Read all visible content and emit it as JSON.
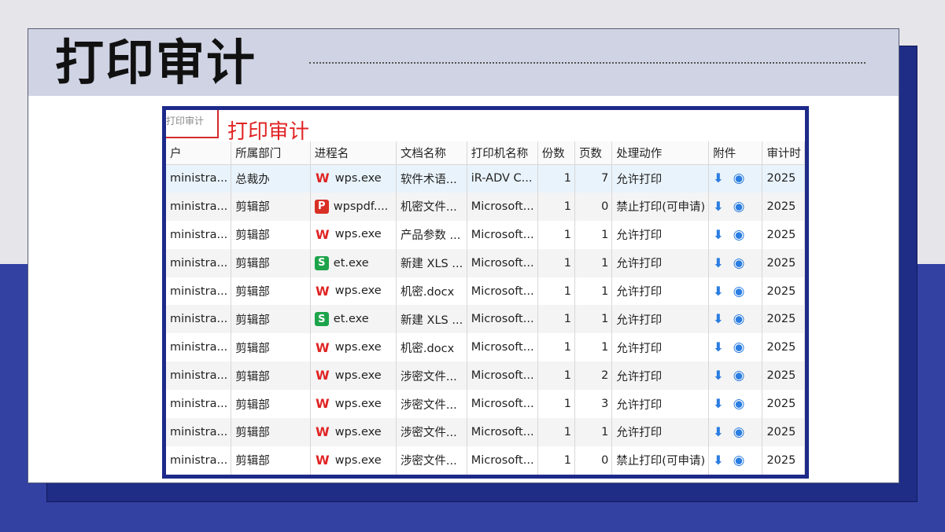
{
  "slide_title": "打印审计",
  "screenshot": {
    "tab_label": "打印审计",
    "overlay_label": "打印审计",
    "columns": [
      "户",
      "所属部门",
      "进程名",
      "文档名称",
      "打印机名称",
      "份数",
      "页数",
      "处理动作",
      "附件",
      "审计时"
    ],
    "rows": [
      {
        "user": "ministra...",
        "dept": "总裁办",
        "proc_icon": "wps-icon",
        "proc": "wps.exe",
        "doc": "软件术语...",
        "printer": "iR-ADV C...",
        "copies": "1",
        "pages": "7",
        "action": "允许打印",
        "time": "2025"
      },
      {
        "user": "ministra...",
        "dept": "剪辑部",
        "proc_icon": "pdf-icon",
        "proc": "wpspdf....",
        "doc": "机密文件...",
        "printer": "Microsoft...",
        "copies": "1",
        "pages": "0",
        "action": "禁止打印(可申请)",
        "time": "2025"
      },
      {
        "user": "ministra...",
        "dept": "剪辑部",
        "proc_icon": "wps-icon",
        "proc": "wps.exe",
        "doc": "产品参数 ...",
        "printer": "Microsoft...",
        "copies": "1",
        "pages": "1",
        "action": "允许打印",
        "time": "2025"
      },
      {
        "user": "ministra...",
        "dept": "剪辑部",
        "proc_icon": "et-icon",
        "proc": "et.exe",
        "doc": "新建 XLS ...",
        "printer": "Microsoft...",
        "copies": "1",
        "pages": "1",
        "action": "允许打印",
        "time": "2025"
      },
      {
        "user": "ministra...",
        "dept": "剪辑部",
        "proc_icon": "wps-icon",
        "proc": "wps.exe",
        "doc": "机密.docx",
        "printer": "Microsoft...",
        "copies": "1",
        "pages": "1",
        "action": "允许打印",
        "time": "2025"
      },
      {
        "user": "ministra...",
        "dept": "剪辑部",
        "proc_icon": "et-icon",
        "proc": "et.exe",
        "doc": "新建 XLS ...",
        "printer": "Microsoft...",
        "copies": "1",
        "pages": "1",
        "action": "允许打印",
        "time": "2025"
      },
      {
        "user": "ministra...",
        "dept": "剪辑部",
        "proc_icon": "wps-icon",
        "proc": "wps.exe",
        "doc": "机密.docx",
        "printer": "Microsoft...",
        "copies": "1",
        "pages": "1",
        "action": "允许打印",
        "time": "2025"
      },
      {
        "user": "ministra...",
        "dept": "剪辑部",
        "proc_icon": "wps-icon",
        "proc": "wps.exe",
        "doc": "涉密文件...",
        "printer": "Microsoft...",
        "copies": "1",
        "pages": "2",
        "action": "允许打印",
        "time": "2025"
      },
      {
        "user": "ministra...",
        "dept": "剪辑部",
        "proc_icon": "wps-icon",
        "proc": "wps.exe",
        "doc": "涉密文件...",
        "printer": "Microsoft...",
        "copies": "1",
        "pages": "3",
        "action": "允许打印",
        "time": "2025"
      },
      {
        "user": "ministra...",
        "dept": "剪辑部",
        "proc_icon": "wps-icon",
        "proc": "wps.exe",
        "doc": "涉密文件...",
        "printer": "Microsoft...",
        "copies": "1",
        "pages": "1",
        "action": "允许打印",
        "time": "2025"
      },
      {
        "user": "ministra...",
        "dept": "剪辑部",
        "proc_icon": "wps-icon",
        "proc": "wps.exe",
        "doc": "涉密文件...",
        "printer": "Microsoft...",
        "copies": "1",
        "pages": "0",
        "action": "禁止打印(可申请)",
        "time": "2025"
      }
    ],
    "attachment_icons": [
      "download-icon",
      "eye-icon"
    ]
  },
  "colors": {
    "accent_blue": "#3241a2",
    "dark_blue": "#1f2d87",
    "header_band": "#cfd3e3",
    "overlay_red": "#e02424",
    "icon_blue": "#2a7de1"
  }
}
